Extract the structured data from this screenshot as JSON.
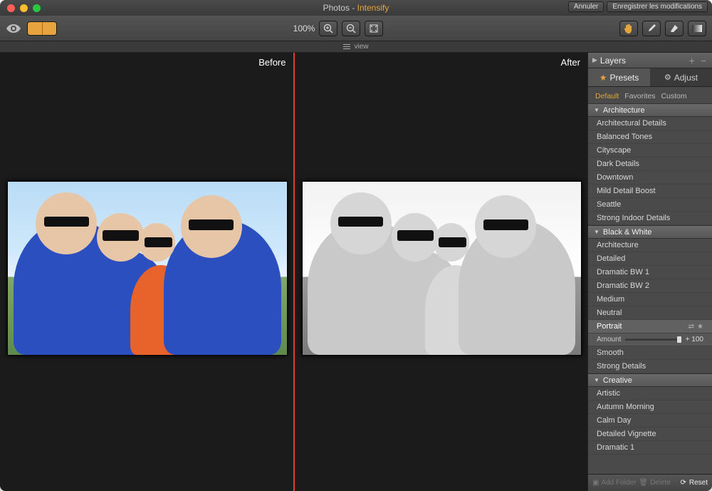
{
  "titlebar": {
    "app": "Photos",
    "separator": " - ",
    "plugin": "Intensify",
    "cancel": "Annuler",
    "save": "Enregistrer les modifications"
  },
  "toolbar": {
    "zoom_label": "100%"
  },
  "viewstrip": {
    "label": "view"
  },
  "canvas": {
    "before_label": "Before",
    "after_label": "After"
  },
  "sidebar": {
    "layers": {
      "title": "Layers"
    },
    "tabs": {
      "presets": "Presets",
      "adjust": "Adjust"
    },
    "subtabs": {
      "default": "Default",
      "favorites": "Favorites",
      "custom": "Custom"
    },
    "categories": [
      {
        "name": "Architecture",
        "presets": [
          "Architectural Details",
          "Balanced Tones",
          "Cityscape",
          "Dark Details",
          "Downtown",
          "Mild Detail Boost",
          "Seattle",
          "Strong Indoor Details"
        ]
      },
      {
        "name": "Black & White",
        "presets": [
          "Architecture",
          "Detailed",
          "Dramatic BW 1",
          "Dramatic BW 2",
          "Medium",
          "Neutral",
          "Portrait",
          "Smooth",
          "Strong Details"
        ],
        "selected": "Portrait",
        "amount_label": "Amount",
        "amount_value": "+ 100"
      },
      {
        "name": "Creative",
        "presets": [
          "Artistic",
          "Autumn Morning",
          "Calm Day",
          "Detailed Vignette",
          "Dramatic 1"
        ]
      }
    ],
    "footer": {
      "add_folder": "Add Folder",
      "delete": "Delete",
      "reset": "Reset"
    }
  }
}
